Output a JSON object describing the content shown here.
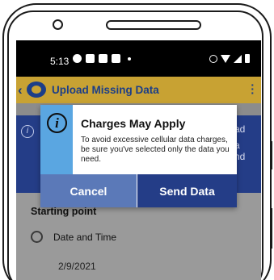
{
  "status_bar": {
    "time": "5:13",
    "left_icons": [
      "app-notification-icon",
      "twitter-icon",
      "email-icon",
      "square-notification-icon",
      "more-dot-icon"
    ],
    "right_icons": [
      "alarm-icon",
      "wifi-icon",
      "signal-icon",
      "battery-icon"
    ]
  },
  "app_bar": {
    "title": "Upload Missing Data",
    "colors": {
      "background": "#c8a233",
      "title": "#1c3e88"
    }
  },
  "info_banner": {
    "partial_text_lines": [
      "ad",
      "a",
      "nd"
    ]
  },
  "dialog": {
    "title": "Charges May Apply",
    "body": "To avoid excessive cellular data charges, be sure you've selected only the data you need.",
    "cancel_label": "Cancel",
    "send_label": "Send Data",
    "colors": {
      "icon_panel": "#5aa6e1",
      "cancel": "#5b79b8",
      "send": "#243d87"
    }
  },
  "content": {
    "section_title": "Starting point",
    "radio_label": "Date and Time",
    "date_value": "2/9/2021"
  }
}
